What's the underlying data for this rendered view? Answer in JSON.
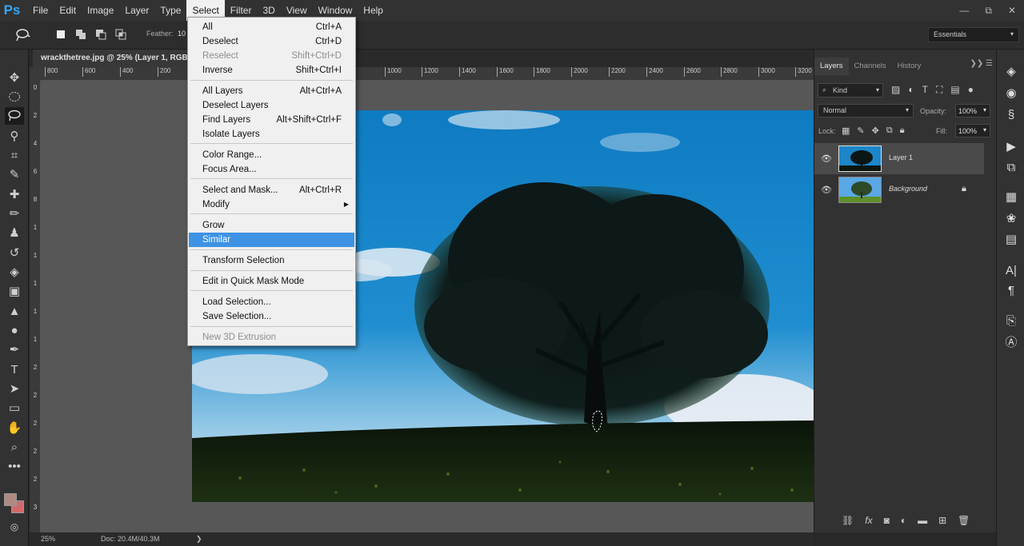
{
  "app": {
    "logo": "Ps"
  },
  "menubar": {
    "items": [
      "File",
      "Edit",
      "Image",
      "Layer",
      "Type",
      "Select",
      "Filter",
      "3D",
      "View",
      "Window",
      "Help"
    ],
    "active": "Select"
  },
  "window_controls": {
    "minimize": "—",
    "restore": "⧉",
    "close": "✕"
  },
  "options": {
    "feather_label": "Feather:",
    "feather_value": "10",
    "workspace": "Essentials"
  },
  "document": {
    "tab_title": "wrackthetree.jpg @ 25% (Layer 1, RGB",
    "zoom": "25%",
    "doc_info": "Doc: 20.4M/40.3M",
    "status_arrow": "❯"
  },
  "rulers": {
    "h_ticks": [
      "800",
      "600",
      "400",
      "200",
      "1000",
      "1200",
      "1400",
      "1600",
      "1800",
      "2000",
      "2200",
      "2400",
      "2600",
      "2800",
      "3000",
      "3200"
    ],
    "v_ticks": [
      "0",
      "2",
      "4",
      "6",
      "8",
      "1",
      "1",
      "1",
      "1",
      "1",
      "2",
      "2",
      "2",
      "2",
      "2",
      "3"
    ]
  },
  "select_menu": {
    "items": [
      {
        "label": "All",
        "shortcut": "Ctrl+A",
        "disabled": false
      },
      {
        "label": "Deselect",
        "shortcut": "Ctrl+D",
        "disabled": false
      },
      {
        "label": "Reselect",
        "shortcut": "Shift+Ctrl+D",
        "disabled": true
      },
      {
        "label": "Inverse",
        "shortcut": "Shift+Ctrl+I",
        "disabled": false
      },
      {
        "label": "All Layers",
        "shortcut": "Alt+Ctrl+A",
        "disabled": false
      },
      {
        "label": "Deselect Layers",
        "shortcut": "",
        "disabled": false
      },
      {
        "label": "Find Layers",
        "shortcut": "Alt+Shift+Ctrl+F",
        "disabled": false
      },
      {
        "label": "Isolate Layers",
        "shortcut": "",
        "disabled": false
      },
      {
        "label": "Color Range...",
        "shortcut": "",
        "disabled": false
      },
      {
        "label": "Focus Area...",
        "shortcut": "",
        "disabled": false
      },
      {
        "label": "Select and Mask...",
        "shortcut": "Alt+Ctrl+R",
        "disabled": false
      },
      {
        "label": "Modify",
        "shortcut": "",
        "disabled": false,
        "submenu": true
      },
      {
        "label": "Grow",
        "shortcut": "",
        "disabled": false
      },
      {
        "label": "Similar",
        "shortcut": "",
        "disabled": false,
        "highlighted": true
      },
      {
        "label": "Transform Selection",
        "shortcut": "",
        "disabled": false
      },
      {
        "label": "Edit in Quick Mask Mode",
        "shortcut": "",
        "disabled": false
      },
      {
        "label": "Load Selection...",
        "shortcut": "",
        "disabled": false
      },
      {
        "label": "Save Selection...",
        "shortcut": "",
        "disabled": false
      },
      {
        "label": "New 3D Extrusion",
        "shortcut": "",
        "disabled": true
      }
    ],
    "submenu_arrow": "▶"
  },
  "layers_panel": {
    "tabs": [
      "Layers",
      "Channels",
      "History"
    ],
    "active_tab": "Layers",
    "tab_end": "❯❯  ☰",
    "kind": "Kind",
    "blend_mode": "Normal",
    "opacity_label": "Opacity:",
    "opacity": "100%",
    "lock_label": "Lock:",
    "fill_label": "Fill:",
    "fill": "100%",
    "layers": [
      {
        "name": "Layer 1",
        "visible": true,
        "selected": true,
        "locked": false
      },
      {
        "name": "Background",
        "visible": true,
        "selected": false,
        "locked": true
      }
    ]
  },
  "colors": {
    "foreground": "#b08a80",
    "background": "#d06a6a",
    "menu_highlight": "#3e92e3",
    "ps_blue": "#31a8ff"
  }
}
